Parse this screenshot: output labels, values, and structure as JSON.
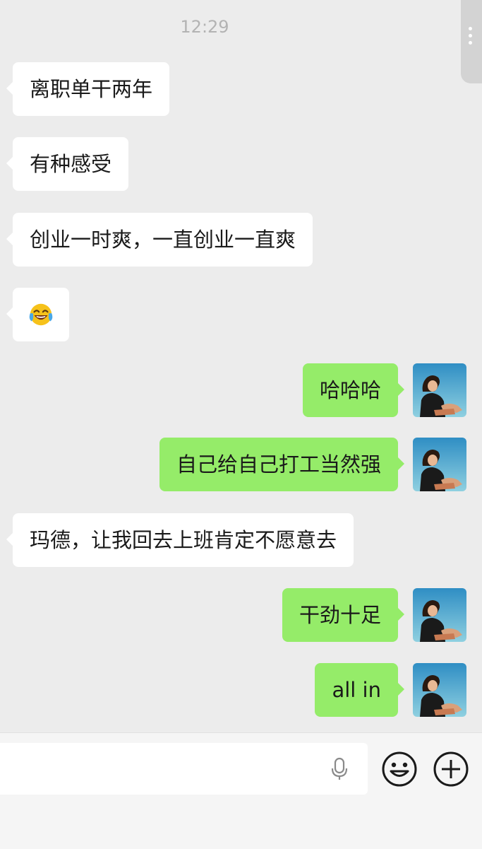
{
  "status": {
    "time": "12:29"
  },
  "messages": [
    {
      "side": "left",
      "text": "离职单干两年"
    },
    {
      "side": "left",
      "text": "有种感受"
    },
    {
      "side": "left",
      "text": "创业一时爽，一直创业一直爽"
    },
    {
      "side": "left",
      "emoji": "face-with-tears-of-joy"
    },
    {
      "side": "right",
      "text": "哈哈哈"
    },
    {
      "side": "right",
      "text": "自己给自己打工当然强"
    },
    {
      "side": "left",
      "text": "玛德，让我回去上班肯定不愿意去"
    },
    {
      "side": "right",
      "text": "干劲十足"
    },
    {
      "side": "right",
      "text": "all in"
    }
  ],
  "colors": {
    "background": "#ececec",
    "incoming_bubble": "#ffffff",
    "outgoing_bubble": "#95ec69",
    "timestamp": "#b3b3b3"
  },
  "input_bar": {
    "icons": [
      "microphone-icon",
      "emoji-icon",
      "plus-icon"
    ]
  }
}
